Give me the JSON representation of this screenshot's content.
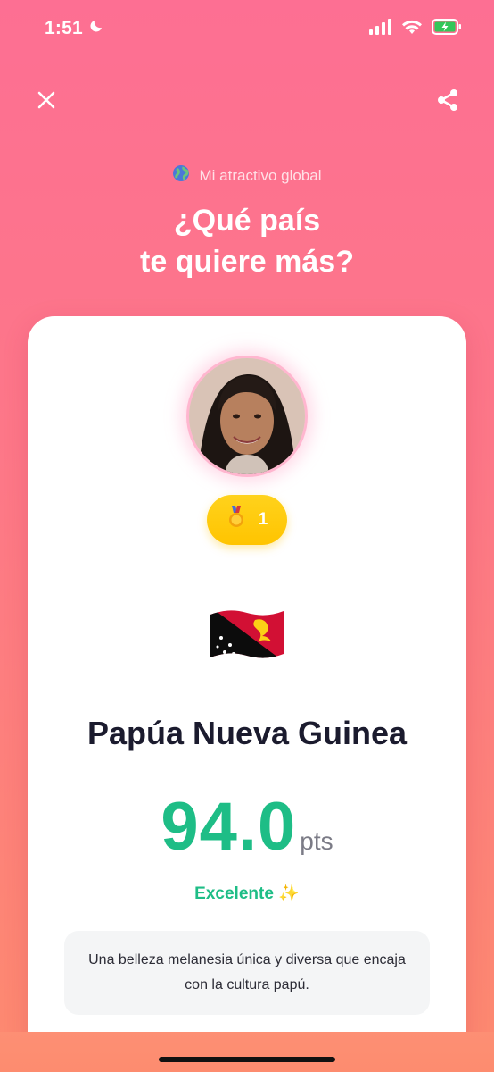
{
  "status_bar": {
    "time": "1:51",
    "icons": [
      "moon-icon",
      "signal-icon",
      "wifi-icon",
      "battery-charging-icon"
    ]
  },
  "toolbar": {
    "close_icon": "close-icon",
    "share_icon": "share-icon"
  },
  "header": {
    "subtitle_icon": "globe-icon",
    "subtitle": "Mi atractivo global",
    "title_line1": "¿Qué país",
    "title_line2": "te quiere más?"
  },
  "result_card": {
    "rank_icon": "medal-icon",
    "rank": "1",
    "flag": "papua-new-guinea-flag",
    "country": "Papúa Nueva Guinea",
    "score": "94.0",
    "score_unit": "pts",
    "rating_label": "Excelente ✨",
    "description": "Una belleza melanesia única y diversa que encaja con la cultura papú."
  },
  "colors": {
    "background_top": "#fd6f93",
    "background_bottom": "#fd8a6f",
    "score": "#1ebd86",
    "rank_pill": "#ffc400",
    "country_text": "#1b1b2e"
  }
}
